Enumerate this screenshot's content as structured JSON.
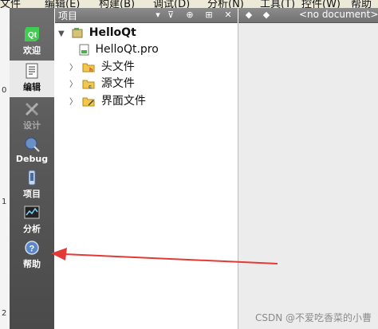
{
  "menubar": {
    "items": [
      "文件",
      "编辑(E)",
      "构建(B)",
      "调试(D)",
      "分析(N)",
      "工具(T)",
      "控件(W)",
      "帮助"
    ]
  },
  "ruler": {
    "labels": [
      "0",
      "1",
      "2"
    ]
  },
  "modes": [
    {
      "name": "mode-welcome",
      "label": "欢迎",
      "icon": "qt-logo-icon"
    },
    {
      "name": "mode-edit",
      "label": "编辑",
      "icon": "edit-document-icon"
    },
    {
      "name": "mode-design",
      "label": "设计",
      "icon": "design-pen-icon"
    },
    {
      "name": "mode-debug",
      "label": "Debug",
      "icon": "debug-bug-icon"
    },
    {
      "name": "mode-projects",
      "label": "项目",
      "icon": "projects-wrench-icon"
    },
    {
      "name": "mode-analyze",
      "label": "分析",
      "icon": "analyze-chart-icon"
    },
    {
      "name": "mode-help",
      "label": "帮助",
      "icon": "help-question-icon"
    }
  ],
  "project_panel": {
    "title": "项目",
    "buttons": [
      "filter-icon",
      "link-icon",
      "split-icon",
      "close-icon"
    ]
  },
  "tree": {
    "root": "HelloQt",
    "items": [
      {
        "label": "HelloQt.pro",
        "icon": "pro-file-icon"
      },
      {
        "label": "头文件",
        "icon": "header-folder-icon"
      },
      {
        "label": "源文件",
        "icon": "source-folder-icon"
      },
      {
        "label": "界面文件",
        "icon": "form-folder-icon"
      }
    ]
  },
  "editor": {
    "document_combo": "<no document>",
    "nav": [
      "back-arrow-icon",
      "forward-arrow-icon"
    ]
  },
  "annotation": {
    "arrow_color": "#e53935"
  },
  "watermark": "CSDN @不爱吃香菜的小曹"
}
